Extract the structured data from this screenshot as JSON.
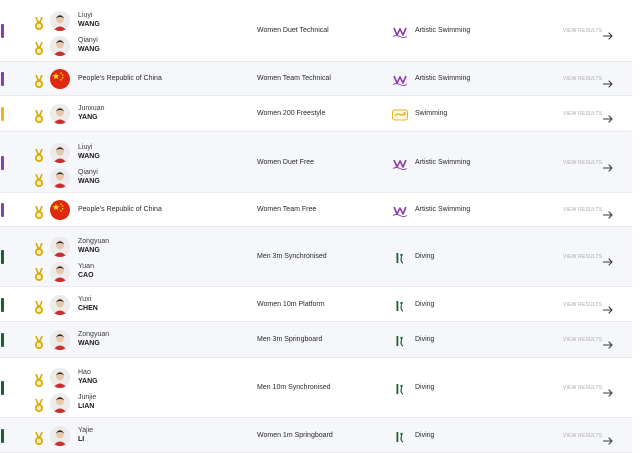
{
  "colors": {
    "artistic": "#8a3ea8",
    "swimming": "#e6b81e",
    "diving": "#1f5e35",
    "gold": "#d8a800",
    "china_red": "#de2910",
    "china_star": "#ffde00"
  },
  "rows": [
    {
      "athletes": [
        {
          "given": "Liuyi",
          "family": "WANG"
        },
        {
          "given": "Qianyi",
          "family": "WANG"
        }
      ],
      "event": "Women Duet Technical",
      "sport": "Artistic Swimming",
      "sport_icon": "artistic-swimming-icon",
      "view": "VIEW RESULTS"
    },
    {
      "country": "People's Republic of China",
      "event": "Women Team Technical",
      "sport": "Artistic Swimming",
      "sport_icon": "artistic-swimming-icon",
      "view": "VIEW RESULTS"
    },
    {
      "athletes": [
        {
          "given": "Junxuan",
          "family": "YANG"
        }
      ],
      "event": "Women 200 Freestyle",
      "sport": "Swimming",
      "sport_icon": "swimming-icon",
      "view": "VIEW RESULTS"
    },
    {
      "athletes": [
        {
          "given": "Liuyi",
          "family": "WANG"
        },
        {
          "given": "Qianyi",
          "family": "WANG"
        }
      ],
      "event": "Women Duet Free",
      "sport": "Artistic Swimming",
      "sport_icon": "artistic-swimming-icon",
      "view": "VIEW RESULTS"
    },
    {
      "country": "People's Republic of China",
      "event": "Women Team Free",
      "sport": "Artistic Swimming",
      "sport_icon": "artistic-swimming-icon",
      "view": "VIEW RESULTS"
    },
    {
      "athletes": [
        {
          "given": "Zongyuan",
          "family": "WANG"
        },
        {
          "given": "Yuan",
          "family": "CAO"
        }
      ],
      "event": "Men 3m Synchronised",
      "sport": "Diving",
      "sport_icon": "diving-icon",
      "view": "VIEW RESULTS"
    },
    {
      "athletes": [
        {
          "given": "Yuxi",
          "family": "CHEN"
        }
      ],
      "event": "Women 10m Platform",
      "sport": "Diving",
      "sport_icon": "diving-icon",
      "view": "VIEW RESULTS"
    },
    {
      "athletes": [
        {
          "given": "Zongyuan",
          "family": "WANG"
        }
      ],
      "event": "Men 3m Springboard",
      "sport": "Diving",
      "sport_icon": "diving-icon",
      "view": "VIEW RESULTS"
    },
    {
      "athletes": [
        {
          "given": "Hao",
          "family": "YANG"
        },
        {
          "given": "Junjie",
          "family": "LIAN"
        }
      ],
      "event": "Men 10m Synchronised",
      "sport": "Diving",
      "sport_icon": "diving-icon",
      "view": "VIEW RESULTS"
    },
    {
      "athletes": [
        {
          "given": "Yajie",
          "family": "LI"
        }
      ],
      "event": "Women 1m Springboard",
      "sport": "Diving",
      "sport_icon": "diving-icon",
      "view": "VIEW RESULTS"
    }
  ]
}
